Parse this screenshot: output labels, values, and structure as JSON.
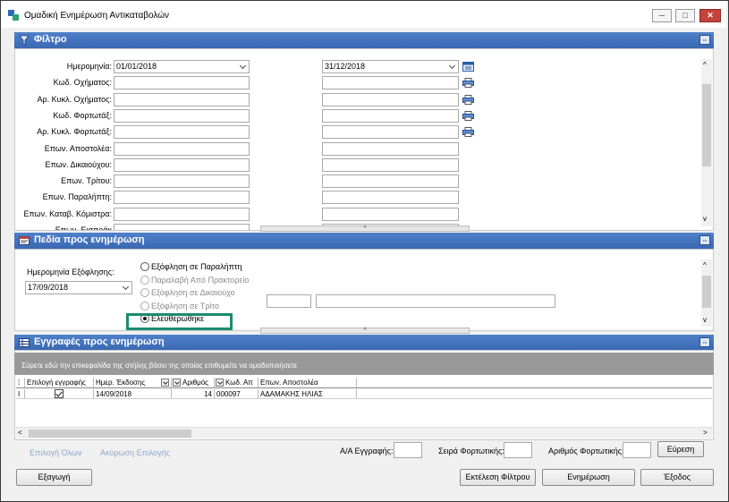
{
  "window": {
    "title": "Ομαδική Ενημέρωση Αντικαταβολών",
    "minimize_glyph": "─",
    "maximize_glyph": "□",
    "close_glyph": "✕"
  },
  "filter": {
    "header": "Φίλτρο",
    "rows": [
      {
        "label": "Ημερομηνία:",
        "from": "01/01/2018",
        "to": "31/12/2018"
      },
      {
        "label": "Κωδ. Οχήματος:",
        "from": "",
        "to": ""
      },
      {
        "label": "Αρ. Κυκλ. Οχήματος:",
        "from": "",
        "to": ""
      },
      {
        "label": "Κωδ. Φορτωτάξ:",
        "from": "",
        "to": ""
      },
      {
        "label": "Αρ. Κυκλ. Φορτωτάξ:",
        "from": "",
        "to": ""
      },
      {
        "label": "Επων. Αποστολέα:",
        "from": "",
        "to": ""
      },
      {
        "label": "Επων. Δικαιούχου:",
        "from": "",
        "to": ""
      },
      {
        "label": "Επων. Τρίτου:",
        "from": "",
        "to": ""
      },
      {
        "label": "Επων. Παραλήπτη:",
        "from": "",
        "to": ""
      },
      {
        "label": "Επων. Καταβ. Κόμιστρα:",
        "from": "",
        "to": ""
      },
      {
        "label": "Επων. Εισπράκ",
        "from": "",
        "to": ""
      }
    ]
  },
  "update_fields": {
    "header": "Πεδία προς ενημέρωση",
    "payment_date_label": "Ημερομηνία Εξόφλησης:",
    "payment_date_value": "17/09/2018",
    "options": [
      {
        "label": "Εξόφληση σε Παραλήπτη",
        "enabled": true,
        "selected": false
      },
      {
        "label": "Παραλαβή Από Πρακτορείο",
        "enabled": false,
        "selected": false
      },
      {
        "label": "Εξόφληση σε Δικαιούχο",
        "enabled": false,
        "selected": false
      },
      {
        "label": "Εξόφληση σε Τρίτο",
        "enabled": false,
        "selected": false
      },
      {
        "label": "Ελευθερώθηκε",
        "enabled": true,
        "selected": true
      }
    ]
  },
  "records": {
    "header": "Εγγραφές προς ενημέρωση",
    "group_hint": "Σύρετε εδώ την επικεφαλίδα της στήλης βάσει της οποίας επιθυμείτε να ομαδοποιήσετε",
    "columns": [
      "Επιλογή εγγραφής",
      "Ημερ. Έκδοσης",
      "Αριθμός",
      "Κωδ. Απ",
      "Επων. Αποστολέα"
    ],
    "rows": [
      {
        "selected": true,
        "date": "14/09/2018",
        "number": "14",
        "code": "000097",
        "sender": "ΑΔΑΜΑΚΗΣ ΗΛΙΑΣ"
      }
    ]
  },
  "footer": {
    "select_all": "Επιλογή Όλων",
    "cancel_selection": "Ακύρωση Επιλογής",
    "record_no_label": "Α/Α Εγγραφής:",
    "waybill_series_label": "Σειρά Φορτωτικής:",
    "waybill_number_label": "Αριθμός Φορτωτικής:",
    "search_button": "Εύρεση",
    "export_button": "Εξαγωγή",
    "run_filter_button": "Εκτέλεση Φίλτρου",
    "update_button": "Ενημέρωση",
    "exit_button": "Έξοδος"
  },
  "colors": {
    "section_header": "#3a68b2",
    "highlight_box": "#1b8c6e",
    "group_bar": "#999999"
  }
}
